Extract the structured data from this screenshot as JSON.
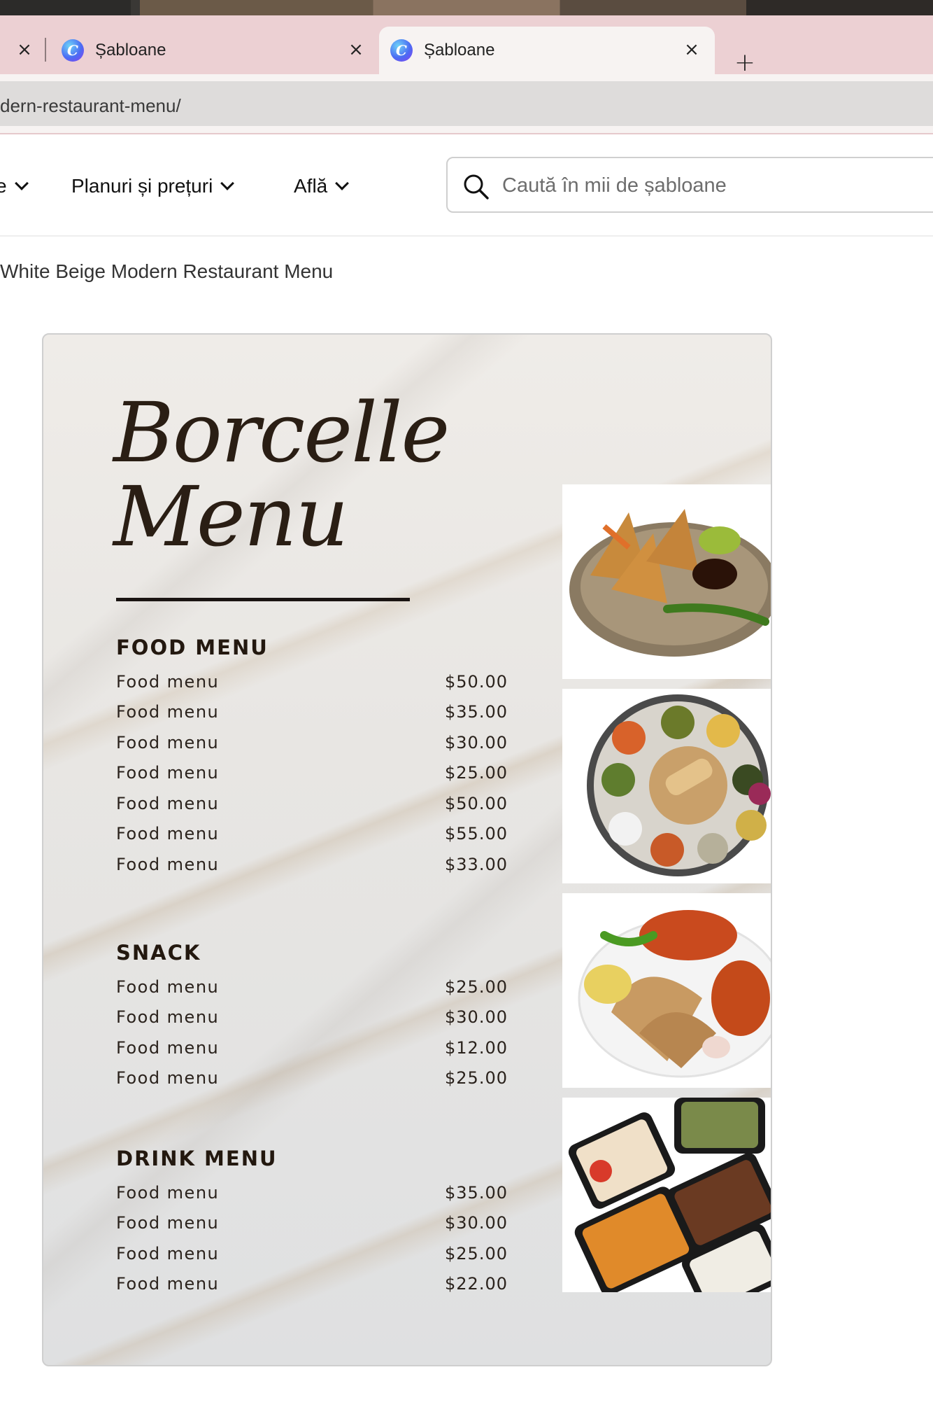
{
  "browser": {
    "tabs": [
      {
        "title": "Șabloane",
        "active": false
      },
      {
        "title": "Șabloane",
        "active": true
      }
    ],
    "close_glyph": "×",
    "new_tab_glyph": "+",
    "url": "dern-restaurant-menu/"
  },
  "header": {
    "nav": [
      {
        "label": "Planuri și prețuri"
      },
      {
        "label": "Află"
      }
    ],
    "search_placeholder": "Caută în mii de șabloane"
  },
  "breadcrumb": "White Beige Modern Restaurant Menu",
  "template": {
    "title_line1": "Borcelle",
    "title_line2": "Menu",
    "sections": [
      {
        "title": "FOOD MENU",
        "items": [
          {
            "name": "Food menu",
            "price": "$50.00"
          },
          {
            "name": "Food menu",
            "price": "$35.00"
          },
          {
            "name": "Food menu",
            "price": "$30.00"
          },
          {
            "name": "Food menu",
            "price": "$25.00"
          },
          {
            "name": "Food menu",
            "price": "$50.00"
          },
          {
            "name": "Food menu",
            "price": "$55.00"
          },
          {
            "name": "Food menu",
            "price": "$33.00"
          }
        ]
      },
      {
        "title": "SNACK",
        "items": [
          {
            "name": "Food menu",
            "price": "$25.00"
          },
          {
            "name": "Food menu",
            "price": "$30.00"
          },
          {
            "name": "Food menu",
            "price": "$12.00"
          },
          {
            "name": "Food menu",
            "price": "$25.00"
          }
        ]
      },
      {
        "title": "DRINK MENU",
        "items": [
          {
            "name": "Food menu",
            "price": "$35.00"
          },
          {
            "name": "Food menu",
            "price": "$30.00"
          },
          {
            "name": "Food menu",
            "price": "$25.00"
          },
          {
            "name": "Food menu",
            "price": "$22.00"
          }
        ]
      }
    ],
    "photos": [
      "samosa-photo",
      "thali-photo",
      "paratha-curry-photo",
      "meal-boxes-photo"
    ]
  },
  "colors": {
    "tabbar": "#ecd0d3",
    "active_tab": "#f7f3f2",
    "menu_text": "#2a1e14"
  }
}
